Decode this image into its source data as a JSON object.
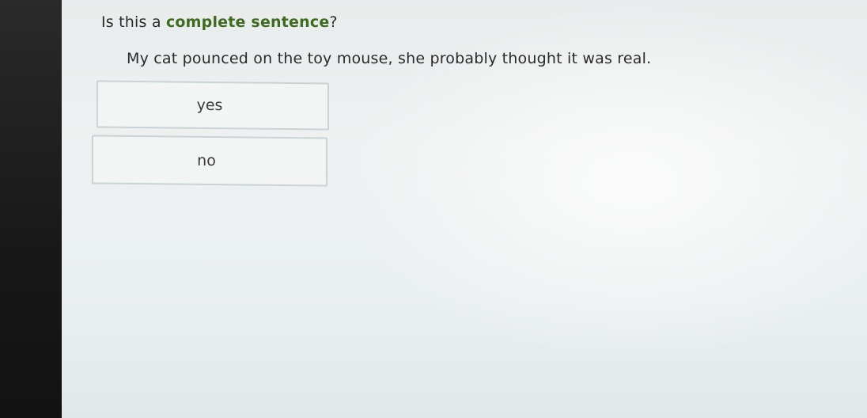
{
  "question": {
    "prefix": "Is this a ",
    "emphasis": "complete sentence",
    "suffix": "?"
  },
  "sentence": "My cat pounced on the toy mouse, she probably thought it was real.",
  "choices": [
    {
      "label": "yes"
    },
    {
      "label": "no"
    }
  ],
  "colors": {
    "emphasis": "#3e6b1f",
    "choice_border": "#c9d3d6"
  }
}
